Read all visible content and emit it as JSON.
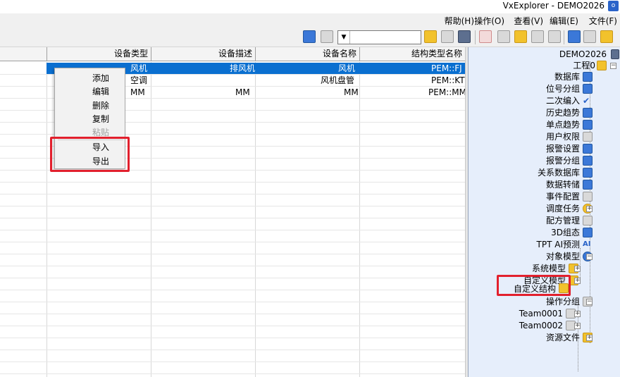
{
  "window": {
    "title": "VxExplorer - DEMO2026",
    "app_icon": "app-logo-icon"
  },
  "menubar": {
    "items": [
      "文件(F)",
      "编辑(E)",
      "查看(V)",
      "操作(O)",
      "帮助(H)"
    ]
  },
  "toolbar": {
    "icons": [
      "open-folder-icon",
      "refresh-icon",
      "save-icon",
      "link-icon",
      "copy-icon",
      "export-icon",
      "add-icon",
      "delete-icon",
      "network-icon",
      "monitor-icon",
      "folder-icon",
      "binoculars-icon",
      "screen-capture-icon"
    ],
    "combo_value": ""
  },
  "grid": {
    "columns": [
      "结构类型名称",
      "设备名称",
      "设备描述",
      "设备类型"
    ],
    "rows": [
      [
        "PEM::FJ",
        "风机",
        "排风机",
        "风机"
      ],
      [
        "PEM::KT",
        "风机盘管",
        "",
        "空调"
      ],
      [
        "PEM::MM",
        "MM",
        "MM",
        "MM"
      ]
    ],
    "selected_row": 0
  },
  "context_menu": {
    "items": [
      {
        "label": "添加",
        "enabled": true
      },
      {
        "label": "编辑",
        "enabled": true
      },
      {
        "label": "删除",
        "enabled": true
      },
      {
        "label": "复制",
        "enabled": true
      },
      {
        "label": "粘贴",
        "enabled": false
      },
      {
        "label": "导入",
        "enabled": true
      },
      {
        "label": "导出",
        "enabled": true
      }
    ]
  },
  "tree": {
    "root": "DEMO2026",
    "project": "工程0",
    "nodes": [
      {
        "label": "数据库",
        "icon": "database-icon"
      },
      {
        "label": "位号分组",
        "icon": "tag-group-icon"
      },
      {
        "label": "二次编入",
        "icon": "check-icon"
      },
      {
        "label": "历史趋势",
        "icon": "history-trend-icon"
      },
      {
        "label": "单点趋势",
        "icon": "point-trend-icon"
      },
      {
        "label": "用户权限",
        "icon": "user-icon"
      },
      {
        "label": "报警设置",
        "icon": "alarm-settings-icon"
      },
      {
        "label": "报警分组",
        "icon": "alarm-group-icon"
      },
      {
        "label": "关系数据库",
        "icon": "relational-db-icon"
      },
      {
        "label": "数据转储",
        "icon": "data-dump-icon"
      },
      {
        "label": "事件配置",
        "icon": "event-config-icon"
      },
      {
        "label": "调度任务",
        "icon": "schedule-icon"
      },
      {
        "label": "配方管理",
        "icon": "recipe-icon"
      },
      {
        "label": "3D组态",
        "icon": "cube-icon"
      },
      {
        "label": "TPT AI预测",
        "icon": "ai-icon"
      },
      {
        "label": "对象模型",
        "icon": "object-model-icon"
      },
      {
        "label": "系统模型",
        "icon": "folder-icon"
      },
      {
        "label": "自定义模型",
        "icon": "folder-icon"
      },
      {
        "label": "自定义结构",
        "icon": "folder-icon"
      },
      {
        "label": "操作分组",
        "icon": "operation-group-icon"
      },
      {
        "label": "Team0001",
        "icon": "team-icon"
      },
      {
        "label": "Team0002",
        "icon": "team-icon"
      },
      {
        "label": "资源文件",
        "icon": "resource-icon"
      }
    ]
  },
  "colors": {
    "selection": "#0a6fd0",
    "highlight": "#e2202d",
    "tree_bg": "#e6eefb"
  }
}
